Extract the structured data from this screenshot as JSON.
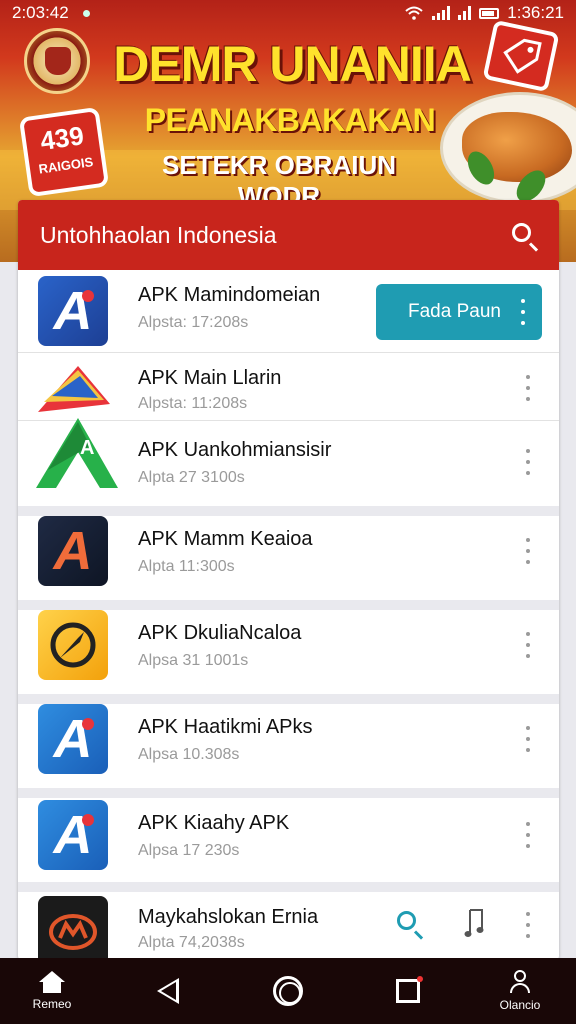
{
  "status_bar": {
    "time_left": "2:03:42",
    "time_right": "1:36:21"
  },
  "banner": {
    "headline": "DEMR UNANIIA",
    "subline": "PEANAKBAKAKAN",
    "tagline": "SETEKR OBRAIUN WODR",
    "sticker_left_big": "439",
    "sticker_left_small": "RAIGOIS"
  },
  "list": {
    "title": "Untohhaolan Indonesia",
    "primary_action_label": "Fada Paun",
    "apps": [
      {
        "name": "APK Mamindomeian",
        "meta": "Alpsta: 17:208s"
      },
      {
        "name": "APK Main Llarin",
        "meta": "Alpsta: 11:208s"
      },
      {
        "name": "APK Uankohmiansisir",
        "meta": "Alpta 27 3100s"
      },
      {
        "name": "APK Mamm Keaioa",
        "meta": "Alpta 11:300s"
      },
      {
        "name": "APK DkuliaNcaloa",
        "meta": "Alpsa 31 1001s"
      },
      {
        "name": "APK Haatikmi APks",
        "meta": "Alpsa 10.308s"
      },
      {
        "name": "APK Kiaahy APK",
        "meta": "Alpsa 17 230s"
      },
      {
        "name": "Maykahslokan Ernia",
        "meta": "Alpta 74,2038s"
      }
    ]
  },
  "nav": {
    "home_label": "Remeo",
    "profile_label": "Olancio"
  },
  "colors": {
    "header_red": "#c8251c",
    "action_teal": "#1f9cb2",
    "nav_dark": "#190707"
  }
}
